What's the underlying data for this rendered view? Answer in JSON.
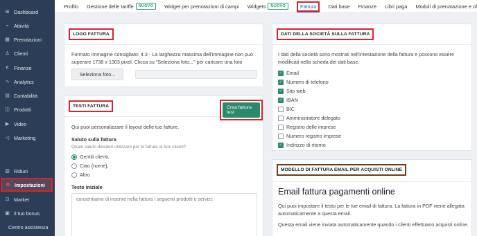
{
  "sidebar": {
    "items": [
      {
        "label": "Dashboard",
        "icon": "dashboard-icon",
        "glyph": "⊞"
      },
      {
        "label": "Attività",
        "icon": "activity-icon",
        "glyph": "⌁"
      },
      {
        "label": "Prenotazioni",
        "icon": "calendar-icon",
        "glyph": "▦"
      },
      {
        "label": "Clienti",
        "icon": "user-icon",
        "glyph": "♙"
      },
      {
        "label": "Finanze",
        "icon": "euro-icon",
        "glyph": "€"
      },
      {
        "label": "Analytics",
        "icon": "analytics-icon",
        "glyph": "∿"
      },
      {
        "label": "Contabilità",
        "icon": "ledger-icon",
        "glyph": "▤"
      },
      {
        "label": "Prodotti",
        "icon": "box-icon",
        "glyph": "◫"
      },
      {
        "label": "Video",
        "icon": "play-icon",
        "glyph": "▶"
      },
      {
        "label": "Marketing",
        "icon": "megaphone-icon",
        "glyph": "◁"
      }
    ],
    "bottom": [
      {
        "label": "Riduci",
        "icon": "collapse-icon",
        "glyph": "▥"
      },
      {
        "label": "Impostazioni",
        "icon": "gear-icon",
        "glyph": "⚙"
      },
      {
        "label": "Market",
        "icon": "cart-icon",
        "glyph": "⊡"
      },
      {
        "label": "Il tuo bonus",
        "icon": "gift-icon",
        "glyph": "▣"
      },
      {
        "label": "Centro assistenza"
      }
    ]
  },
  "tabs": {
    "profilo": "Profilo",
    "tariffe": "Gestione delle tariffe",
    "badge_nuovo": "NUOVO",
    "widget_campi": "Widget per prenotazioni di campi",
    "widgets": "Widgets",
    "fattura": "Fattura",
    "dati_base": "Dati base",
    "finanze": "Finanze",
    "libri_paga": "Libri paga",
    "moduli": "Moduli di prenotazione e offerte"
  },
  "logo_card": {
    "title": "LOGO FATTURA",
    "desc": "Formato immagine consigliato: 4:3 - La larghezza massima dell'immagine non può superare 1738 x 1303 pixel. Clicca su \"Seleziona foto...\" per caricare una foto",
    "select_btn": "Seleziona foto..."
  },
  "testi_card": {
    "title": "TESTI FATTURA",
    "create_btn": "Crea fattura test",
    "intro": "Qui puoi personalizzare il layout delle tue fatture.",
    "saluto_label": "Saluto sulla fattura",
    "saluto_hint": "Quale saluto desideri utilizzare per le fatture ai tuoi clienti?",
    "options": [
      "Gentili clienti,",
      "Ciao {nome},",
      "Altro"
    ],
    "testo_label": "Testo iniziale",
    "testo_value": "consentiamo di inserire nella fattura i seguenti prodotti e servizi:"
  },
  "dati_card": {
    "title": "DATI DELLA SOCIETÀ SULLA FATTURA",
    "desc": "I dati della società sono mostrati nell'intestazione della fattura e possono essere modificati nella scheda dei dati base.",
    "fields": [
      {
        "label": "Email",
        "checked": true
      },
      {
        "label": "Numero di telefono",
        "checked": true
      },
      {
        "label": "Sito web",
        "checked": true
      },
      {
        "label": "IBAN",
        "checked": true
      },
      {
        "label": "BIC",
        "checked": false
      },
      {
        "label": "Amministratore delegato",
        "checked": false
      },
      {
        "label": "Registro delle imprese",
        "checked": false
      },
      {
        "label": "Numero registro imprese",
        "checked": false
      },
      {
        "label": "Indirizzo di ritorno",
        "checked": true
      }
    ]
  },
  "email_card": {
    "title": "MODELLO DI FATTURA EMAIL PER ACQUISTI ONLINE",
    "heading": "Email fattura pagamenti online",
    "p1": "Qui puoi impostare il testo per le tue email di fattura. La fattura in PDF viene allegata automaticamente a questa email.",
    "p2": "Questa email viene inviata automaticamente quando i clienti effettuano acquisti online."
  },
  "colors": {
    "sidebar": "#2c3e57",
    "accent_green": "#2b8a6c",
    "highlight_red": "#d9232d",
    "highlight_brown": "#6b3b1a"
  }
}
